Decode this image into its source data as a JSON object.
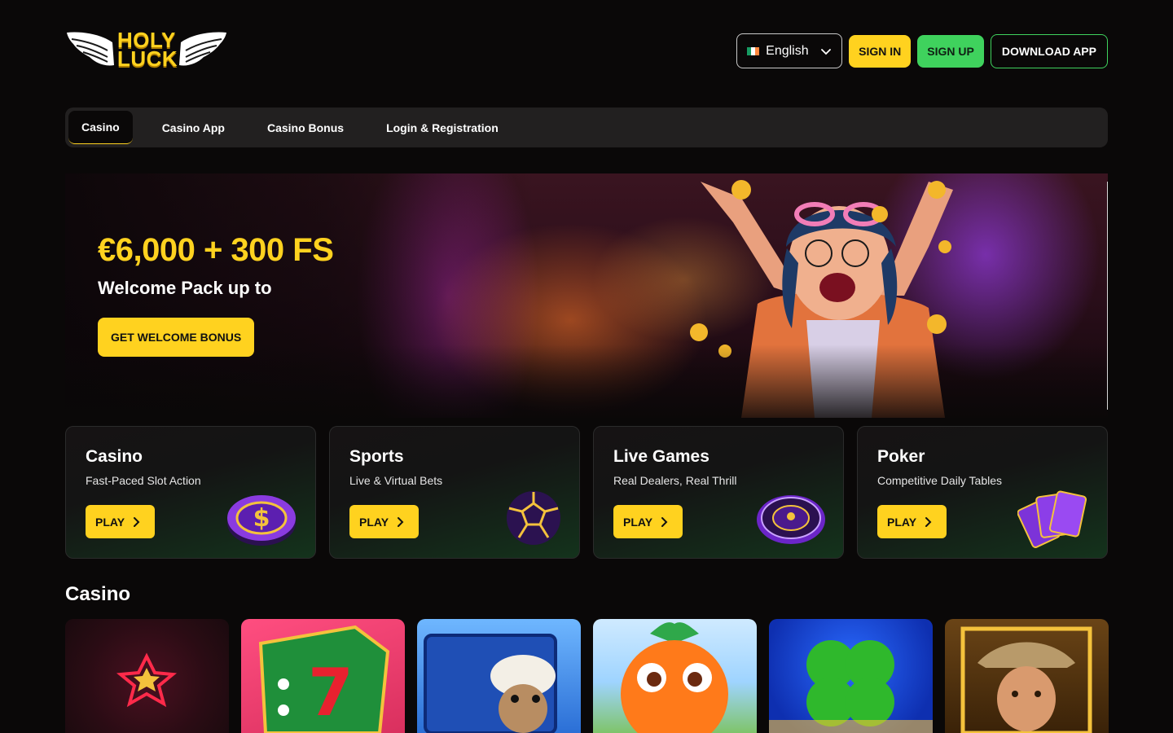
{
  "brand": {
    "logo_line1": "HOLY",
    "logo_line2": "LUCK"
  },
  "header": {
    "language": "English",
    "sign_in": "SIGN IN",
    "sign_up": "SIGN UP",
    "download_app": "DOWNLOAD APP"
  },
  "nav": {
    "items": [
      {
        "label": "Casino",
        "active": true
      },
      {
        "label": "Casino App"
      },
      {
        "label": "Casino Bonus"
      },
      {
        "label": "Login & Registration"
      }
    ]
  },
  "hero": {
    "title": "€6,000 + 300 FS",
    "subtitle": "Welcome Pack up to",
    "cta": "GET WELCOME BONUS"
  },
  "categories": [
    {
      "title": "Casino",
      "subtitle": "Fast-Paced Slot Action",
      "button": "PLAY",
      "icon": "casino-chip-icon"
    },
    {
      "title": "Sports",
      "subtitle": "Live & Virtual Bets",
      "button": "PLAY",
      "icon": "soccer-ball-icon"
    },
    {
      "title": "Live Games",
      "subtitle": "Real Dealers, Real Thrill",
      "button": "PLAY",
      "icon": "roulette-wheel-icon"
    },
    {
      "title": "Poker",
      "subtitle": "Competitive Daily Tables",
      "button": "PLAY",
      "icon": "playing-cards-icon"
    }
  ],
  "casino_section": {
    "title": "Casino",
    "games": [
      "neon-star-game",
      "lucky-seven-dice-game",
      "sheep-dice-game",
      "orange-character-game",
      "four-leaf-clover-game",
      "adventurer-game"
    ]
  },
  "colors": {
    "accent_yellow": "#ffd21f",
    "accent_green": "#3fd25d",
    "background": "#0a0808",
    "nav_bg": "#222020"
  }
}
